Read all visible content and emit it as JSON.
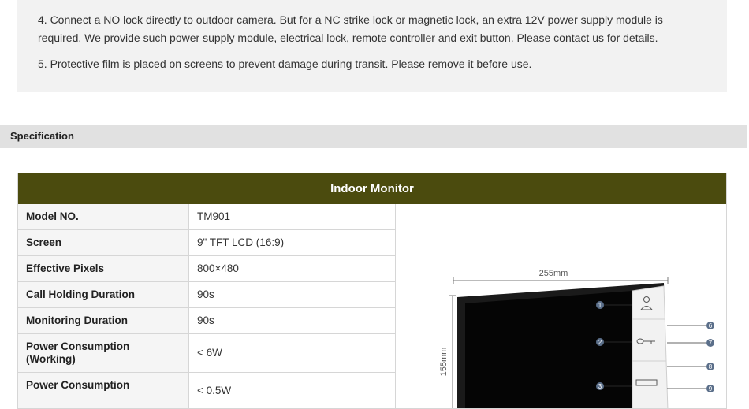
{
  "notes": {
    "note4_line1": "4. Connect a NO lock directly to outdoor camera. But for a NC strike lock or magnetic lock, an extra 12V power supply module is",
    "note4_line2": "required. We provide such power supply module, electrical lock, remote controller and exit button. Please contact us for details.",
    "note5": "5. Protective film is placed on screens to prevent damage during transit. Please remove it before use."
  },
  "section": {
    "title": "Specification"
  },
  "table": {
    "header": "Indoor Monitor",
    "rows": [
      {
        "label": "Model NO.",
        "value": "TM901"
      },
      {
        "label": "Screen",
        "value": "9\" TFT LCD (16:9)"
      },
      {
        "label": "Effective Pixels",
        "value": "800×480"
      },
      {
        "label": "Call Holding Duration",
        "value": "90s"
      },
      {
        "label": "Monitoring Duration",
        "value": "90s"
      },
      {
        "label": "Power Consumption (Working)",
        "value": "< 6W"
      },
      {
        "label": "Power Consumption",
        "value": "< 0.5W"
      }
    ]
  },
  "diagram": {
    "width_label": "255mm",
    "height_label": "155mm",
    "callouts": [
      "1",
      "2",
      "3",
      "6",
      "7",
      "8",
      "9"
    ]
  }
}
